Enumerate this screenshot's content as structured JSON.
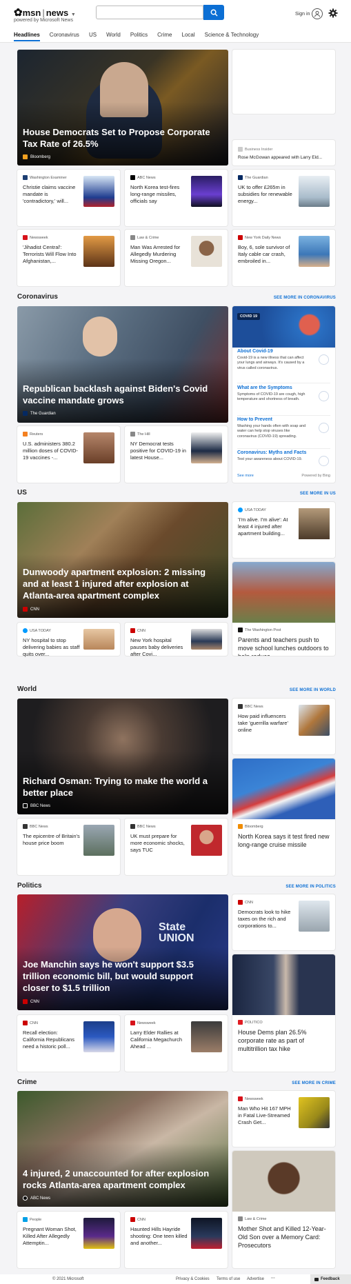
{
  "header": {
    "brand": "msn",
    "section": "news",
    "powered_by": "powered by Microsoft News",
    "search_placeholder": "",
    "signin": "Sign in"
  },
  "nav": [
    "Headlines",
    "Coronavirus",
    "US",
    "World",
    "Politics",
    "Crime",
    "Local",
    "Science & Technology"
  ],
  "headlines": {
    "hero": {
      "title": "House Democrats Set to Propose Corporate Tax Rate of 26.5%",
      "source": "Bloomberg"
    },
    "side": {
      "source": "Business Insider",
      "title": "Rose McGowan appeared with Larry Eld..."
    },
    "cards": [
      {
        "source": "Washington Examiner",
        "title": "Christie claims vaccine mandate is 'contradictory,' will..."
      },
      {
        "source": "ABC News",
        "title": "North Korea test-fires long-range missiles, officials say"
      },
      {
        "source": "The Guardian",
        "title": "UK to offer £265m in subsidies for renewable energy..."
      },
      {
        "source": "Newsweek",
        "title": "'Jihadist Central': Terrorists Will Flow Into Afghanistan,..."
      },
      {
        "source": "Law & Crime",
        "title": "Man Was Arrested for Allegedly Murdering Missing Oregon..."
      },
      {
        "source": "New York Daily News",
        "title": "Boy, 6, sole survivor of Italy cable car crash, embroiled in..."
      }
    ]
  },
  "coronavirus": {
    "title": "Coronavirus",
    "see_more": "SEE MORE IN CORONAVIRUS",
    "hero": {
      "title": "Republican backlash against Biden's Covid vaccine mandate grows",
      "source": "The Guardian"
    },
    "cards": [
      {
        "source": "Reuters",
        "title": "U.S. administers 380.2 million doses of COVID-19 vaccines -..."
      },
      {
        "source": "The Hill",
        "title": "NY Democrat tests positive for COVID-19 in latest House..."
      }
    ],
    "panel": {
      "badge": "COVID 19",
      "items": [
        {
          "h": "About Covid-19",
          "b": "Covid-19 is a new illness that can affect your lungs and airways. It's caused by a virus called coronavirus."
        },
        {
          "h": "What are the Symptoms",
          "b": "Symptoms of COVID-19 are cough, high temperature and shortness of breath."
        },
        {
          "h": "How to Prevent",
          "b": "Washing your hands often with soap and water can help stop viruses like coronavirus (COVID-19) spreading."
        },
        {
          "h": "Coronavirus: Myths and Facts",
          "b": "Test your awareness about COVID-19."
        }
      ],
      "see_more": "See more",
      "powered": "Powered by Bing"
    }
  },
  "us": {
    "title": "US",
    "see_more": "SEE MORE IN US",
    "hero": {
      "title": "Dunwoody apartment explosion: 2 missing and at least 1 injured after explosion at Atlanta-area apartment complex",
      "source": "CNN"
    },
    "side": {
      "source": "USA TODAY",
      "title": "'I'm alive. I'm alive': At least 4 injured after apartment building..."
    },
    "tall": {
      "source": "The Washington Post",
      "title": "Parents and teachers push to move school lunches outdoors to help reduce..."
    },
    "cards": [
      {
        "source": "USA TODAY",
        "title": "NY hospital to stop delivering babies as staff quits over..."
      },
      {
        "source": "CNN",
        "title": "New York hospital pauses baby deliveries after Covi..."
      }
    ]
  },
  "world": {
    "title": "World",
    "see_more": "SEE MORE IN WORLD",
    "hero": {
      "title": "Richard Osman: Trying to make the world a better place",
      "source": "BBC News"
    },
    "side": {
      "source": "BBC News",
      "title": "How paid influencers take 'guerrilla warfare' online"
    },
    "tall": {
      "source": "Bloomberg",
      "title": "North Korea says it test fired new long-range cruise missile"
    },
    "cards": [
      {
        "source": "BBC News",
        "title": "The epicentre of Britain's house price boom"
      },
      {
        "source": "BBC News",
        "title": "UK must prepare for more economic shocks, says TUC"
      }
    ]
  },
  "politics": {
    "title": "Politics",
    "see_more": "SEE MORE IN POLITICS",
    "hero": {
      "title": "Joe Manchin says he won't support $3.5 trillion economic bill, but would support closer to $1.5 trillion",
      "source": "CNN",
      "overlay": "State UNION"
    },
    "side": {
      "source": "CNN",
      "title": "Democrats look to hike taxes on the rich and corporations to..."
    },
    "tall": {
      "source": "POLITICO",
      "title": "House Dems plan 26.5% corporate rate as part of multitrillion tax hike"
    },
    "cards": [
      {
        "source": "CNN",
        "title": "Recall election: California Republicans need a historic poll..."
      },
      {
        "source": "Newsweek",
        "title": "Larry Elder Rallies at California Megachurch Ahead ..."
      }
    ]
  },
  "crime": {
    "title": "Crime",
    "see_more": "SEE MORE IN CRIME",
    "hero": {
      "title": "4 injured, 2 unaccounted for after explosion rocks Atlanta-area apartment complex",
      "source": "ABC News"
    },
    "side": {
      "source": "Newsweek",
      "title": "Man Who Hit 167 MPH in Fatal Live-Streamed Crash Get..."
    },
    "tall": {
      "source": "Law & Crime",
      "title": "Mother Shot and Killed 12-Year-Old Son over a Memory Card: Prosecutors"
    },
    "cards": [
      {
        "source": "People",
        "title": "Pregnant Woman Shot, Killed After Allegedly Attemptin..."
      },
      {
        "source": "CNN",
        "title": "Haunted Hills Hayride shooting: One teen killed and another..."
      }
    ]
  },
  "footer": {
    "copyright": "© 2021 Microsoft",
    "privacy": "Privacy & Cookies",
    "terms": "Terms of use",
    "advertise": "Advertise",
    "more": "···",
    "feedback": "Feedback"
  }
}
